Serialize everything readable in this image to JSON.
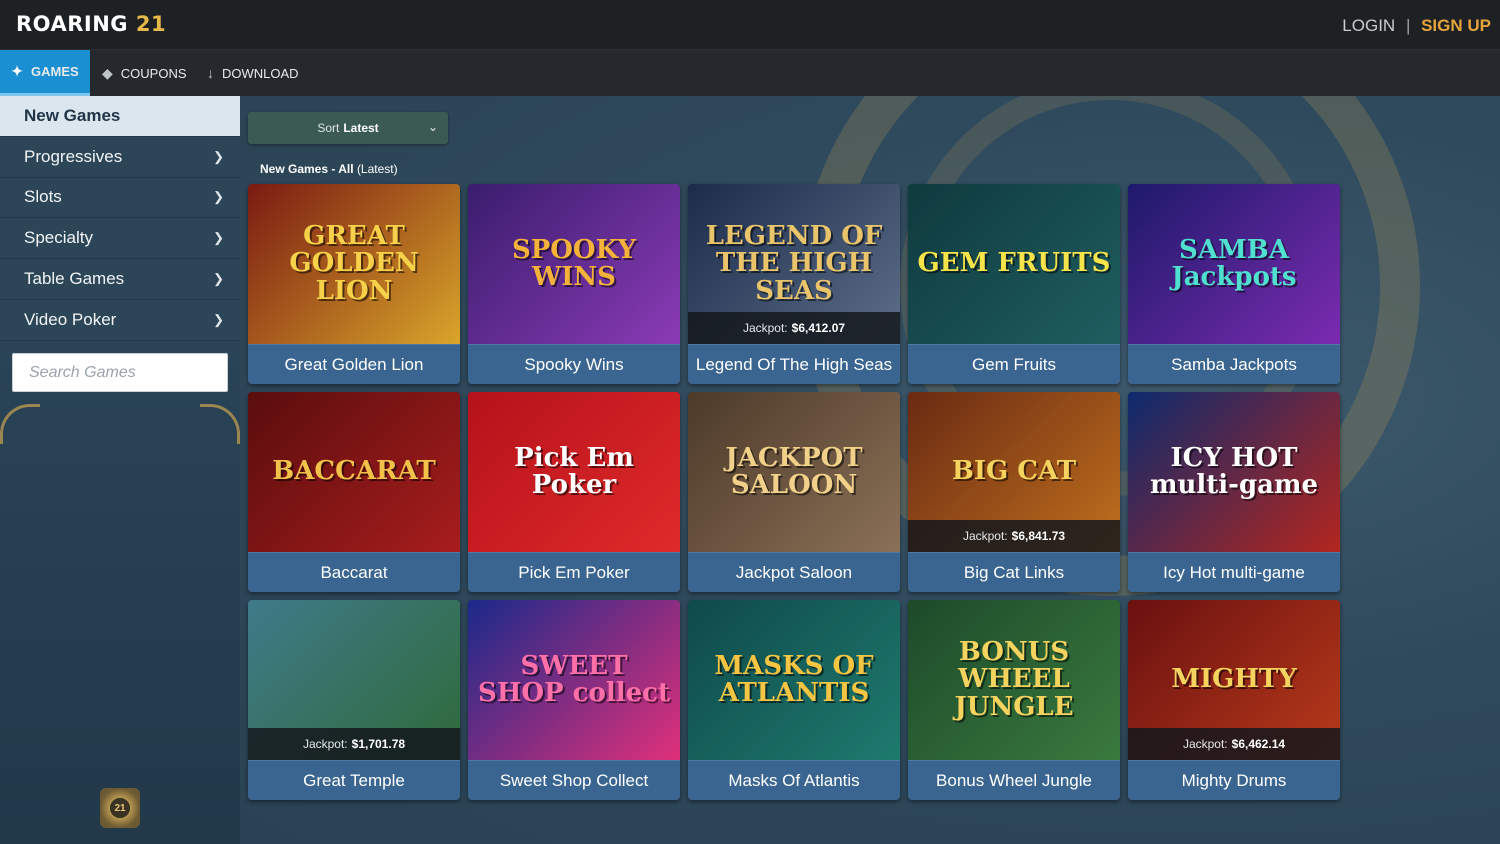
{
  "header": {
    "logo_text": "ROARING",
    "logo_num": "21",
    "login": "LOGIN",
    "separator": "|",
    "signup": "SIGN UP"
  },
  "nav": {
    "games": "GAMES",
    "coupons": "COUPONS",
    "download": "DOWNLOAD"
  },
  "sidebar": {
    "items": [
      {
        "label": "New Games"
      },
      {
        "label": "Progressives"
      },
      {
        "label": "Slots"
      },
      {
        "label": "Specialty"
      },
      {
        "label": "Table Games"
      },
      {
        "label": "Video Poker"
      }
    ],
    "search_placeholder": "Search Games",
    "chip_text": "21"
  },
  "main": {
    "sort_prefix": "Sort",
    "sort_value": "Latest",
    "section_bold": "New Games - All",
    "section_rest": "(Latest)"
  },
  "games": [
    {
      "title": "Great Golden Lion",
      "art": "GREAT GOLDEN LION",
      "jackpot": null,
      "colors": [
        "#7a1a12",
        "#d9a52a"
      ],
      "ink": "#f7d14a"
    },
    {
      "title": "Spooky Wins",
      "art": "SPOOKY WINS",
      "jackpot": null,
      "colors": [
        "#3a1d6e",
        "#8a3bb5"
      ],
      "ink": "#f5b23a"
    },
    {
      "title": "Legend Of The High Seas",
      "art": "LEGEND OF THE HIGH SEAS",
      "jackpot": "$6,412.07",
      "colors": [
        "#1b2b4a",
        "#5d6f8a"
      ],
      "ink": "#e9c46a"
    },
    {
      "title": "Gem Fruits",
      "art": "GEM FRUITS",
      "jackpot": null,
      "colors": [
        "#0f3a3e",
        "#1f5e60"
      ],
      "ink": "#f7e34a"
    },
    {
      "title": "Samba Jackpots",
      "art": "SAMBA Jackpots",
      "jackpot": null,
      "colors": [
        "#1d1a6a",
        "#7b2bb0"
      ],
      "ink": "#4fe0d0"
    },
    {
      "title": "Baccarat",
      "art": "BACCARAT",
      "jackpot": null,
      "colors": [
        "#5a0d0d",
        "#a81d1d"
      ],
      "ink": "#f2c14a"
    },
    {
      "title": "Pick Em Poker",
      "art": "Pick Em Poker",
      "jackpot": null,
      "colors": [
        "#b5121b",
        "#e02a2a"
      ],
      "ink": "#ffffff"
    },
    {
      "title": "Jackpot Saloon",
      "art": "JACKPOT SALOON",
      "jackpot": null,
      "colors": [
        "#4d3a2a",
        "#8a7056"
      ],
      "ink": "#f1d08a"
    },
    {
      "title": "Big Cat Links",
      "art": "BIG CAT",
      "jackpot": "$6,841.73",
      "colors": [
        "#6a2a12",
        "#c0701e"
      ],
      "ink": "#f4d35e"
    },
    {
      "title": "Icy Hot multi-game",
      "art": "ICY HOT multi-game",
      "jackpot": null,
      "colors": [
        "#0d2a6e",
        "#b3261e"
      ],
      "ink": "#ffffff"
    },
    {
      "title": "Great Temple",
      "art": "",
      "jackpot": "$1,701.78",
      "colors": [
        "#3f7a8a",
        "#2f6a3a"
      ],
      "ink": "#f4d35e"
    },
    {
      "title": "Sweet Shop Collect",
      "art": "SWEET SHOP collect",
      "jackpot": null,
      "colors": [
        "#1a2a8a",
        "#e0307a"
      ],
      "ink": "#ff6fa8"
    },
    {
      "title": "Masks Of Atlantis",
      "art": "MASKS OF ATLANTIS",
      "jackpot": null,
      "colors": [
        "#0f4a4a",
        "#1e7a6e"
      ],
      "ink": "#f4c542"
    },
    {
      "title": "Bonus Wheel Jungle",
      "art": "BONUS WHEEL JUNGLE",
      "jackpot": null,
      "colors": [
        "#1d4a2a",
        "#3a7a3e"
      ],
      "ink": "#f4d35e"
    },
    {
      "title": "Mighty Drums",
      "art": "MIGHTY",
      "jackpot": "$6,462.14",
      "colors": [
        "#6a1010",
        "#b83a1a"
      ],
      "ink": "#f4d35e"
    }
  ],
  "jackpot_label": "Jackpot:"
}
